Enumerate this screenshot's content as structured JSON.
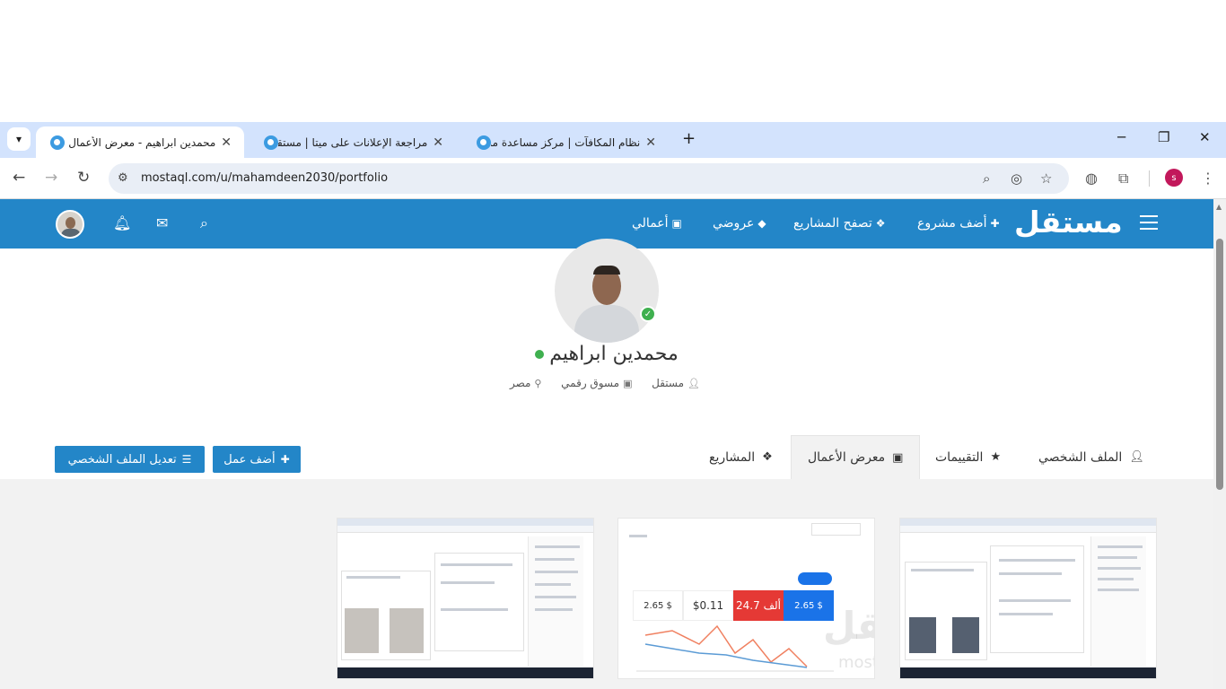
{
  "browser": {
    "tabs": [
      {
        "title": "محمدين ابراهيم - معرض الأعمال | ",
        "active": true
      },
      {
        "title": "مراجعة الإعلانات على ميتا | مستقل",
        "active": false
      },
      {
        "title": "نظام المكافآت | مركز مساعدة مس",
        "active": false
      }
    ],
    "url": "mostaql.com/u/mahamdeen2030/portfolio",
    "profile_initial": "s"
  },
  "header": {
    "logo": "مستقل",
    "nav": {
      "add_project": "أضف مشروع",
      "browse_projects": "تصفح المشاريع",
      "my_bids": "عروضي",
      "my_works": "أعمالي"
    }
  },
  "profile": {
    "name": "محمدين ابراهيم",
    "role": "مستقل",
    "title": "مسوق رقمي",
    "country": "مصر"
  },
  "tabs": {
    "profile": "الملف الشخصي",
    "reviews": "التقييمات",
    "portfolio": "معرض الأعمال",
    "projects": "المشاريع"
  },
  "actions": {
    "add_work": "أضف عمل",
    "edit_profile": "تعديل الملف الشخصي"
  },
  "gallery": {
    "middle_metrics": [
      "2.65 $",
      "24.7 ألف",
      "$0.11",
      "2.65 $"
    ],
    "watermark": "مستقل",
    "watermark_sub": "mostaql.com"
  },
  "colors": {
    "brand": "#2386c8",
    "online": "#3fb04f"
  }
}
